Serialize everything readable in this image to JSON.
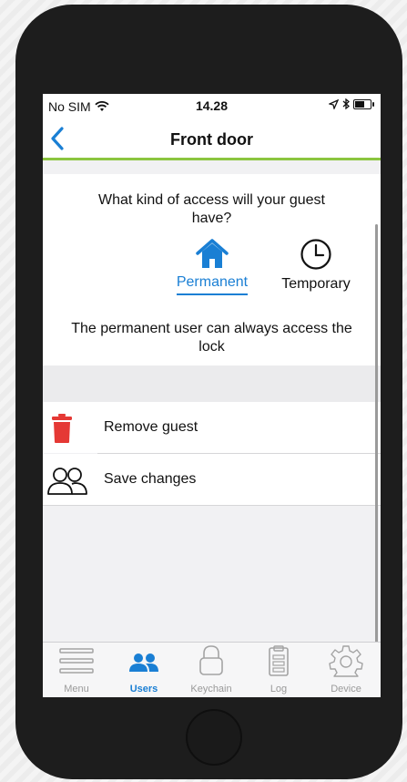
{
  "status": {
    "carrier": "No SIM",
    "time": "14.28"
  },
  "nav": {
    "title": "Front door"
  },
  "access": {
    "question": "What kind of access will your guest have?",
    "options": [
      {
        "label": "Permanent",
        "selected": true,
        "icon": "house-icon"
      },
      {
        "label": "Temporary",
        "selected": false,
        "icon": "clock-icon"
      }
    ],
    "description": "The permanent user can always access the lock"
  },
  "actions": [
    {
      "label": "Remove guest",
      "icon": "trash-icon",
      "color": "#e53935"
    },
    {
      "label": "Save changes",
      "icon": "users-icon"
    }
  ],
  "tabs": [
    {
      "label": "Menu",
      "icon": "menu-icon",
      "active": false
    },
    {
      "label": "Users",
      "icon": "users-icon",
      "active": true
    },
    {
      "label": "Keychain",
      "icon": "padlock-icon",
      "active": false
    },
    {
      "label": "Log",
      "icon": "clipboard-icon",
      "active": false
    },
    {
      "label": "Device",
      "icon": "gear-icon",
      "active": false
    }
  ],
  "colors": {
    "accent": "#1a7fd4",
    "nav_underline": "#8bc53f",
    "danger": "#e53935"
  }
}
